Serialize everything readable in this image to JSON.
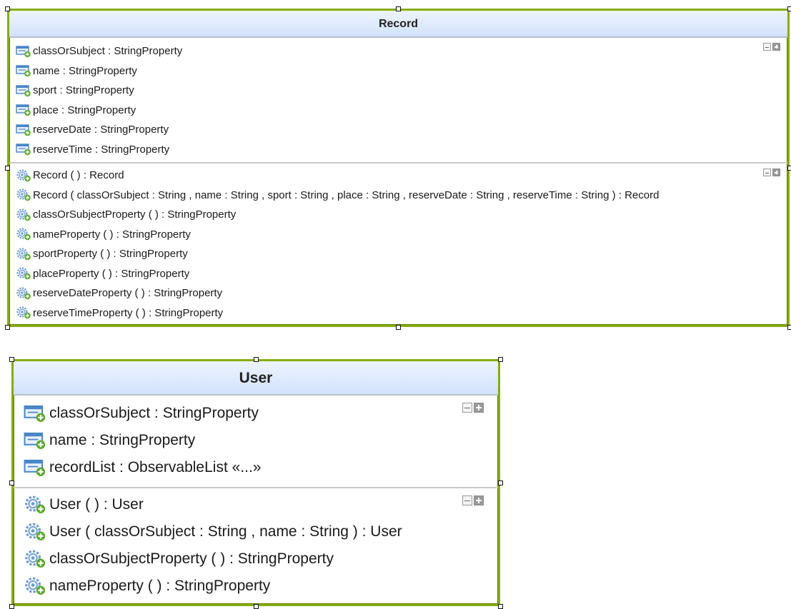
{
  "classes": [
    {
      "id": "record",
      "name": "Record",
      "attributes": [
        "classOrSubject : StringProperty",
        "name : StringProperty",
        "sport : StringProperty",
        "place : StringProperty",
        "reserveDate : StringProperty",
        "reserveTime : StringProperty"
      ],
      "operations": [
        "Record ( ) :  Record",
        "Record ( classOrSubject : String , name : String , sport : String , place : String , reserveDate : String , reserveTime : String  ) :  Record",
        "classOrSubjectProperty ( ) :  StringProperty",
        "nameProperty ( ) :  StringProperty",
        "sportProperty ( ) :  StringProperty",
        "placeProperty ( ) :  StringProperty",
        "reserveDateProperty ( ) :  StringProperty",
        "reserveTimeProperty ( ) :  StringProperty"
      ]
    },
    {
      "id": "user",
      "name": "User",
      "attributes": [
        "classOrSubject : StringProperty",
        "name : StringProperty",
        "recordList : ObservableList  «...»"
      ],
      "operations": [
        "User ( ) :  User",
        "User ( classOrSubject : String , name : String  ) :  User",
        "classOrSubjectProperty ( ) :  StringProperty",
        "nameProperty ( ) :  StringProperty"
      ]
    }
  ],
  "icons": {
    "attribute": "attribute-icon",
    "operation": "operation-gear-icon",
    "compartment_control": "collapse-expand-icon"
  },
  "colors": {
    "class_border": "#86ac10",
    "header_top": "#eef4ff",
    "header_bottom": "#d2e2fb",
    "attribute_icon": "#4a86c8",
    "add_badge": "#5aa92a"
  }
}
